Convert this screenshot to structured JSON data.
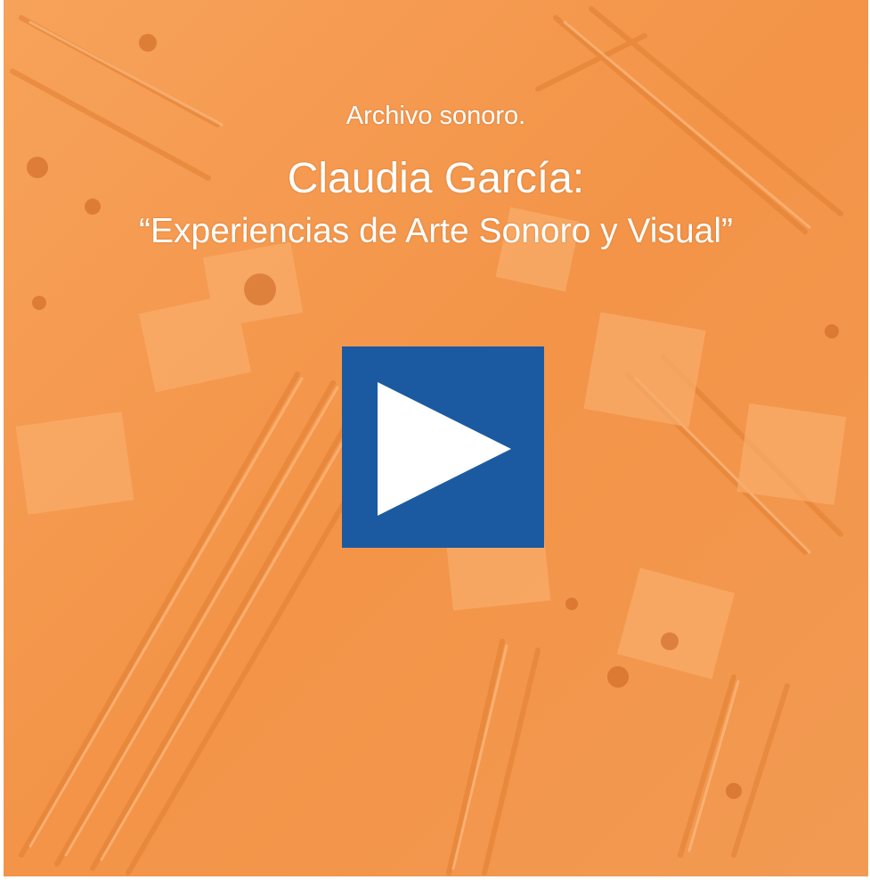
{
  "cover": {
    "subtitle": "Archivo sonoro.",
    "title": "Claudia García:",
    "tagline": "“Experiencias de Arte Sonoro y Visual”"
  },
  "play_button": {
    "icon": "play-icon",
    "color": "#1b5aa0"
  },
  "colors": {
    "background": "#f49a4f",
    "text": "#ffffff"
  }
}
